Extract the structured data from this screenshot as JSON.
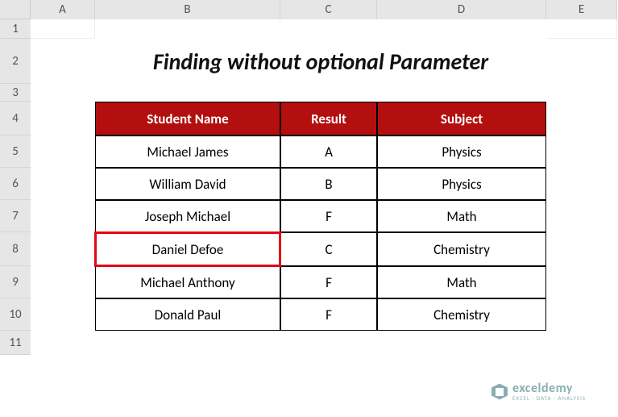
{
  "columns": [
    "A",
    "B",
    "C",
    "D",
    "E"
  ],
  "rows": [
    "1",
    "2",
    "3",
    "4",
    "5",
    "6",
    "7",
    "8",
    "9",
    "10",
    "11"
  ],
  "title": "Finding without optional Parameter",
  "headers": {
    "b": "Student Name",
    "c": "Result",
    "d": "Subject"
  },
  "data": [
    {
      "name": "Michael James",
      "result": "A",
      "subject": "Physics"
    },
    {
      "name": "William David",
      "result": "B",
      "subject": "Physics"
    },
    {
      "name": "Joseph Michael",
      "result": "F",
      "subject": "Math"
    },
    {
      "name": "Daniel Defoe",
      "result": "C",
      "subject": "Chemistry"
    },
    {
      "name": "Michael Anthony",
      "result": "F",
      "subject": "Math"
    },
    {
      "name": "Donald Paul",
      "result": "F",
      "subject": "Chemistry"
    }
  ],
  "highlighted_cell": "B8",
  "watermark": {
    "main": "exceldemy",
    "sub": "EXCEL · DATA · ANALYSIS"
  },
  "col_widths": {
    "A": 80,
    "B": 230,
    "C": 120,
    "D": 210,
    "E": 88
  },
  "row_heights": {
    "1": 24,
    "2": 56,
    "3": 22,
    "4": 42,
    "5": 40,
    "6": 40,
    "7": 40,
    "8": 42,
    "9": 40,
    "10": 40,
    "11": 30
  }
}
